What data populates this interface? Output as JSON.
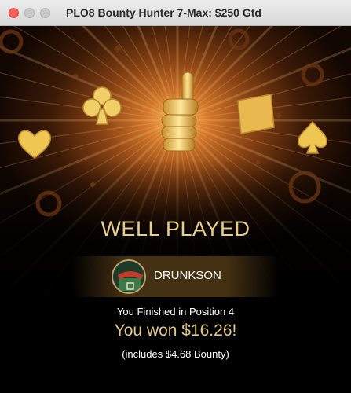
{
  "window": {
    "title": "PLO8 Bounty Hunter 7-Max: $250 Gtd",
    "buttons": [
      "close",
      "minimize",
      "maximize"
    ]
  },
  "celebration": {
    "icons": [
      "thumbs-up-icon",
      "club-icon",
      "diamond-icon",
      "heart-icon",
      "spade-icon",
      "poker-chip-icon"
    ],
    "headline": "WELL PLAYED"
  },
  "player": {
    "name": "DRUNKSON"
  },
  "result": {
    "finish_text": "You Finished in Position 4",
    "won_text": "You won $16.26!",
    "bounty_text": "(includes $4.68 Bounty)"
  },
  "colors": {
    "gold": "#e8cd85",
    "glow": "#ffb85a",
    "close_button": "#fe5f57"
  }
}
